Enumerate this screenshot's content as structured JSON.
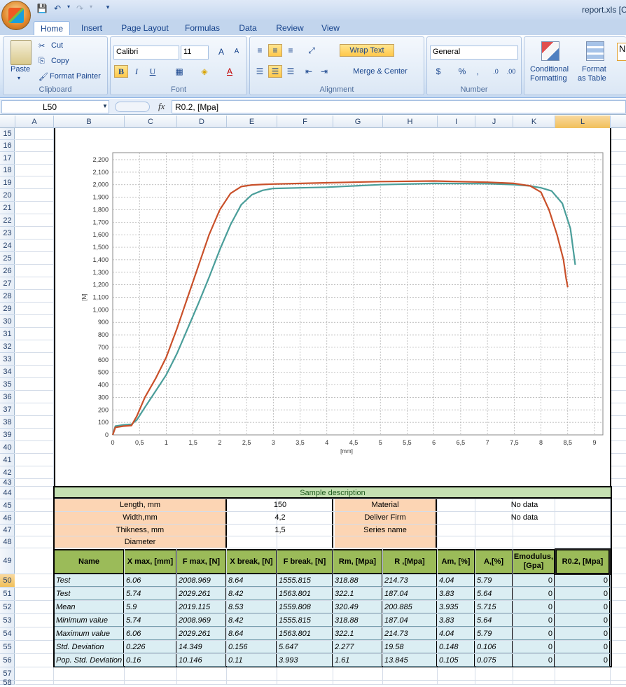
{
  "window": {
    "title": "report.xls [C"
  },
  "ribbon": {
    "tabs": [
      "Home",
      "Insert",
      "Page Layout",
      "Formulas",
      "Data",
      "Review",
      "View"
    ],
    "clipboard": {
      "paste": "Paste",
      "cut": "Cut",
      "copy": "Copy",
      "format_painter": "Format Painter",
      "label": "Clipboard"
    },
    "font": {
      "name": "Calibri",
      "size": "11",
      "bold": "B",
      "italic": "I",
      "underline": "U",
      "label": "Font"
    },
    "alignment": {
      "wrap": "Wrap Text",
      "merge": "Merge & Center",
      "label": "Alignment"
    },
    "number": {
      "format": "General",
      "currency": "$",
      "percent": "%",
      "comma": ",",
      "label": "Number"
    },
    "styles": {
      "conditional": "Conditional",
      "formatting": "Formatting",
      "format_as": "Format",
      "table": "as Table",
      "cut_label": "N"
    }
  },
  "formula_bar": {
    "cell": "L50",
    "fx": "fx",
    "value": "R0.2, [Mpa]"
  },
  "columns": [
    "A",
    "B",
    "C",
    "D",
    "E",
    "F",
    "G",
    "H",
    "I",
    "J",
    "K",
    "L"
  ],
  "rows": [
    "15",
    "16",
    "17",
    "18",
    "19",
    "20",
    "21",
    "22",
    "23",
    "24",
    "25",
    "26",
    "27",
    "28",
    "29",
    "30",
    "31",
    "32",
    "33",
    "34",
    "35",
    "36",
    "37",
    "38",
    "39",
    "40",
    "41",
    "42",
    "43",
    "44",
    "45",
    "46",
    "47",
    "48",
    "49",
    "50",
    "51",
    "52",
    "53",
    "54",
    "55",
    "56",
    "57",
    "58"
  ],
  "chart_data": {
    "type": "line",
    "xlabel": "[mm]",
    "ylabel": "[N]",
    "xlim": [
      0,
      9
    ],
    "ylim": [
      0,
      2200
    ],
    "xticks": [
      "0",
      "0,5",
      "1",
      "1,5",
      "2",
      "2,5",
      "3",
      "3,5",
      "4",
      "4,5",
      "5",
      "5,5",
      "6",
      "6,5",
      "7",
      "7,5",
      "8",
      "8,5",
      "9"
    ],
    "yticks": [
      "0",
      "100",
      "200",
      "300",
      "400",
      "500",
      "600",
      "700",
      "800",
      "900",
      "1,000",
      "1,100",
      "1,200",
      "1,300",
      "1,400",
      "1,500",
      "1,600",
      "1,700",
      "1,800",
      "1,900",
      "2,000",
      "2,100",
      "2,200"
    ],
    "grid": true,
    "series": [
      {
        "color": "#c9502a",
        "x": [
          0,
          0.05,
          0.2,
          0.35,
          0.45,
          0.6,
          0.8,
          1.0,
          1.2,
          1.4,
          1.6,
          1.8,
          2.0,
          2.2,
          2.4,
          2.6,
          2.8,
          3.0,
          4.0,
          5.0,
          6.0,
          7.0,
          7.5,
          7.8,
          8.0,
          8.15,
          8.3,
          8.42,
          8.47,
          8.5
        ],
        "y": [
          0,
          60,
          70,
          75,
          150,
          300,
          450,
          620,
          850,
          1100,
          1350,
          1600,
          1800,
          1930,
          1985,
          1998,
          2002,
          2005,
          2015,
          2025,
          2029,
          2020,
          2010,
          1990,
          1940,
          1800,
          1600,
          1400,
          1250,
          1180
        ]
      },
      {
        "color": "#4a9e9a",
        "x": [
          0,
          0.05,
          0.2,
          0.35,
          0.45,
          0.6,
          0.8,
          1.0,
          1.2,
          1.4,
          1.6,
          1.8,
          2.0,
          2.2,
          2.4,
          2.6,
          2.8,
          3.0,
          3.5,
          4.0,
          5.0,
          6.0,
          7.0,
          7.5,
          7.8,
          8.0,
          8.2,
          8.4,
          8.55,
          8.64
        ],
        "y": [
          0,
          70,
          80,
          85,
          120,
          220,
          350,
          480,
          650,
          850,
          1050,
          1260,
          1480,
          1680,
          1840,
          1920,
          1955,
          1970,
          1975,
          1980,
          2000,
          2010,
          2008,
          2000,
          1990,
          1975,
          1950,
          1850,
          1650,
          1360
        ]
      }
    ]
  },
  "sample": {
    "title": "Sample description",
    "rows": [
      {
        "label": "Length, mm",
        "value": "150",
        "label2": "Material",
        "value2": "No data"
      },
      {
        "label": "Width,mm",
        "value": "4,2",
        "label2": "Deliver Firm",
        "value2": "No data"
      },
      {
        "label": "Thikness, mm",
        "value": "1,5",
        "label2": "Series name",
        "value2": ""
      },
      {
        "label": "Diameter",
        "value": "",
        "label2": "",
        "value2": ""
      }
    ]
  },
  "results": {
    "headers": [
      "Name",
      "X max, [mm]",
      "F max, [N]",
      "X break, [N]",
      "F break, [N]",
      "Rm, [Mpa]",
      "R ,[Mpa]",
      "Am, [%]",
      "A,[%]",
      "Emodulus, [Gpa]",
      "R0.2, [Mpa]"
    ],
    "rows": [
      [
        "Test",
        "6.06",
        "2008.969",
        "8.64",
        "1555.815",
        "318.88",
        "214.73",
        "4.04",
        "5.79",
        "0",
        "0"
      ],
      [
        "Test",
        "5.74",
        "2029.261",
        "8.42",
        "1563.801",
        "322.1",
        "187.04",
        "3.83",
        "5.64",
        "0",
        "0"
      ],
      [
        "Mean",
        "5.9",
        "2019.115",
        "8.53",
        "1559.808",
        "320.49",
        "200.885",
        "3.935",
        "5.715",
        "0",
        "0"
      ],
      [
        "Minimum value",
        "5.74",
        "2008.969",
        "8.42",
        "1555.815",
        "318.88",
        "187.04",
        "3.83",
        "5.64",
        "0",
        "0"
      ],
      [
        "Maximum value",
        "6.06",
        "2029.261",
        "8.64",
        "1563.801",
        "322.1",
        "214.73",
        "4.04",
        "5.79",
        "0",
        "0"
      ],
      [
        "Std. Deviation",
        "0.226",
        "14.349",
        "0.156",
        "5.647",
        "2.277",
        "19.58",
        "0.148",
        "0.106",
        "0",
        "0"
      ],
      [
        "Pop. Std. Deviation",
        "0.16",
        "10.146",
        "0.11",
        "3.993",
        "1.61",
        "13.845",
        "0.105",
        "0.075",
        "0",
        "0"
      ]
    ]
  }
}
